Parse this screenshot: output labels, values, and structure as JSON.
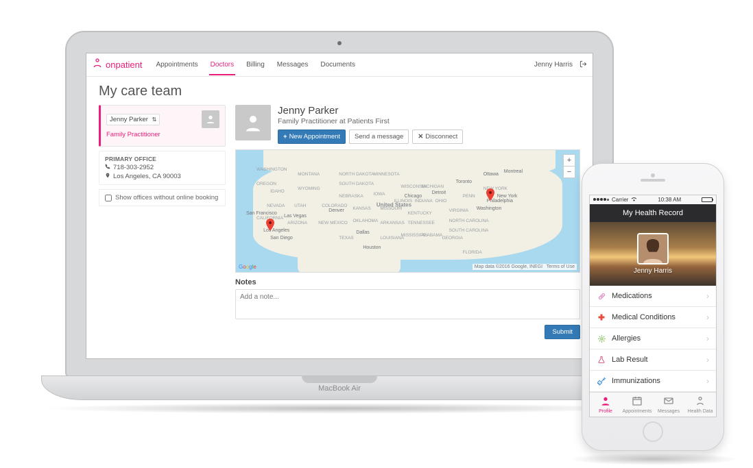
{
  "laptop": {
    "brand": "MacBook Air"
  },
  "web": {
    "brand": "onpatient",
    "nav": {
      "appointments": "Appointments",
      "doctors": "Doctors",
      "billing": "Billing",
      "messages": "Messages",
      "documents": "Documents"
    },
    "user": "Jenny Harris",
    "page_title": "My care team",
    "sidebar": {
      "provider_name": "Jenny Parker",
      "role": "Family Practitioner",
      "office_label": "PRIMARY OFFICE",
      "phone": "718-303-2952",
      "address": "Los Angeles, CA 90003",
      "checkbox_label": "Show offices without online booking"
    },
    "doctor": {
      "name": "Jenny Parker",
      "subtitle": "Family Practitioner at Patients First",
      "new_appt": "New Appointment",
      "send_msg": "Send a message",
      "disconnect": "Disconnect"
    },
    "map": {
      "center_label": "United States",
      "states": [
        "MONTANA",
        "WYOMING",
        "IDAHO",
        "OREGON",
        "NEVADA",
        "UTAH",
        "COLORADO",
        "ARIZONA",
        "NEW MEXICO",
        "TEXAS",
        "OKLAHOMA",
        "KANSAS",
        "NEBRASKA",
        "SOUTH DAKOTA",
        "NORTH DAKOTA",
        "MINNESOTA",
        "WISCONSIN",
        "IOWA",
        "MISSOURI",
        "ARKANSAS",
        "LOUISIANA",
        "MISSISSIPPI",
        "ALABAMA",
        "GEORGIA",
        "TENNESSEE",
        "KENTUCKY",
        "ILLINOIS",
        "INDIANA",
        "OHIO",
        "PENN",
        "VIRGINIA",
        "NORTH CAROLINA",
        "SOUTH CAROLINA",
        "FLORIDA",
        "NEW YORK",
        "MICHIGAN",
        "CALIFORNIA",
        "WASHINGTON"
      ],
      "cities": {
        "san_francisco": "San Francisco",
        "los_angeles": "Los Angeles",
        "san_diego": "San Diego",
        "las_vegas": "Las Vegas",
        "denver": "Denver",
        "dallas": "Dallas",
        "houston": "Houston",
        "chicago": "Chicago",
        "detroit": "Detroit",
        "toronto": "Toronto",
        "ottawa": "Ottawa",
        "montreal": "Montreal",
        "new_york": "New York",
        "philadelphia": "Philadelphia",
        "washington": "Washington"
      },
      "attribution": "Map data ©2016 Google, INEGI",
      "terms": "Terms of Use"
    },
    "notes": {
      "label": "Notes",
      "placeholder": "Add a note...",
      "submit": "Submit"
    }
  },
  "phone": {
    "statusbar": {
      "carrier": "Carrier",
      "time": "10:38 AM"
    },
    "header": "My Health Record",
    "hero_name": "Jenny Harris",
    "list": {
      "medications": "Medications",
      "conditions": "Medical Conditions",
      "allergies": "Allergies",
      "lab": "Lab Result",
      "immunizations": "Immunizations"
    },
    "tabs": {
      "profile": "Profile",
      "appointments": "Appointments",
      "messages": "Messages",
      "health_data": "Health Data"
    }
  }
}
